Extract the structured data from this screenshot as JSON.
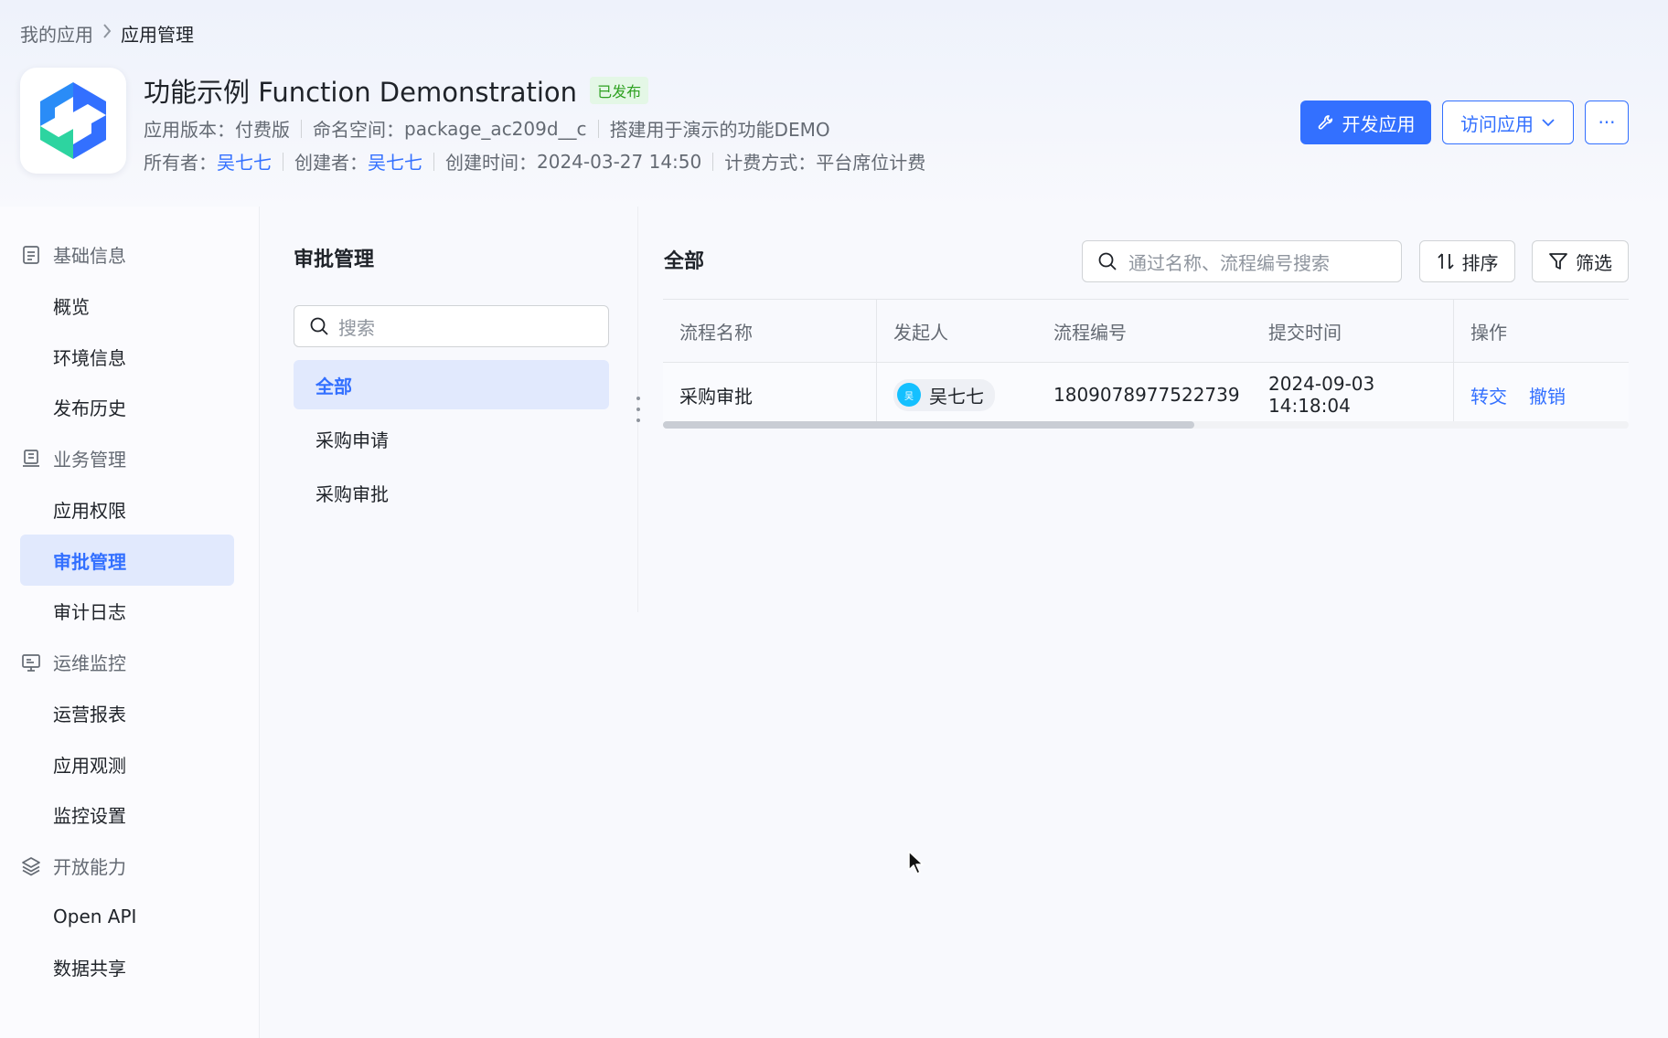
{
  "breadcrumb": {
    "parent": "我的应用",
    "separator": ">",
    "current": "应用管理"
  },
  "app": {
    "title": "功能示例 Function Demonstration",
    "status": "已发布",
    "version_label": "应用版本：",
    "version_value": "付费版",
    "namespace_label": "命名空间：",
    "namespace_value": "package_ac209d__c",
    "description": "搭建用于演示的功能DEMO",
    "owner_label": "所有者：",
    "owner_value": "吴七七",
    "creator_label": "创建者：",
    "creator_value": "吴七七",
    "created_label": "创建时间：",
    "created_value": "2024-03-27 14:50",
    "billing_label": "计费方式：",
    "billing_value": "平台席位计费"
  },
  "actions": {
    "develop": "开发应用",
    "visit": "访问应用",
    "more": "···"
  },
  "nav": {
    "groups": [
      {
        "label": "基础信息",
        "icon": "document-icon",
        "items": [
          "概览",
          "环境信息",
          "发布历史"
        ]
      },
      {
        "label": "业务管理",
        "icon": "briefcase-icon",
        "items": [
          "应用权限",
          "审批管理",
          "审计日志"
        ]
      },
      {
        "label": "运维监控",
        "icon": "monitor-icon",
        "items": [
          "运营报表",
          "应用观测",
          "监控设置"
        ]
      },
      {
        "label": "开放能力",
        "icon": "layers-icon",
        "items": [
          "Open API",
          "数据共享"
        ]
      }
    ],
    "active_item": "审批管理"
  },
  "approval": {
    "title": "审批管理",
    "search_placeholder": "搜索",
    "categories": [
      "全部",
      "采购申请",
      "采购审批"
    ],
    "active_category": "全部"
  },
  "content": {
    "title": "全部",
    "search_placeholder": "通过名称、流程编号搜索",
    "sort_label": "排序",
    "filter_label": "筛选",
    "columns": [
      "流程名称",
      "发起人",
      "流程编号",
      "提交时间",
      "操作"
    ],
    "rows": [
      {
        "name": "采购审批",
        "initiator": "吴七七",
        "initiator_avatar": "吴",
        "number": "1809078977522739",
        "submit_time": "2024-09-03 14:18:04",
        "actions": [
          "转交",
          "撤销"
        ]
      }
    ],
    "scroll_fraction_visible": 0.55
  },
  "colors": {
    "accent": "#3370ff",
    "active_bg": "#e1e9fd",
    "badge_green": "#2ea121",
    "avatar": "#14c0ff"
  }
}
